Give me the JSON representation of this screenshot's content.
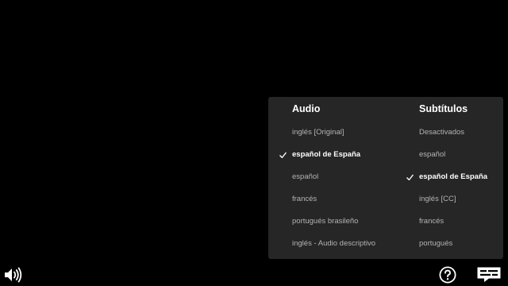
{
  "audio": {
    "title": "Audio",
    "options": [
      {
        "label": "inglés [Original]",
        "selected": false
      },
      {
        "label": "español de España",
        "selected": true
      },
      {
        "label": "español",
        "selected": false
      },
      {
        "label": "francés",
        "selected": false
      },
      {
        "label": "portugués brasileño",
        "selected": false
      },
      {
        "label": "inglés - Audio descriptivo",
        "selected": false
      }
    ]
  },
  "subtitles": {
    "title": "Subtítulos",
    "options": [
      {
        "label": "Desactivados",
        "selected": false
      },
      {
        "label": "español",
        "selected": false
      },
      {
        "label": "español de España",
        "selected": true
      },
      {
        "label": "inglés [CC]",
        "selected": false
      },
      {
        "label": "francés",
        "selected": false
      },
      {
        "label": "portugués",
        "selected": false
      }
    ]
  },
  "controls": {
    "volume_icon": "volume-icon",
    "help_icon": "help-icon",
    "subtitles_icon": "audio-subtitles-icon"
  },
  "colors": {
    "background": "#000000",
    "panel": "#262626",
    "option_text": "#b3b3b3",
    "selected_text": "#ffffff"
  }
}
